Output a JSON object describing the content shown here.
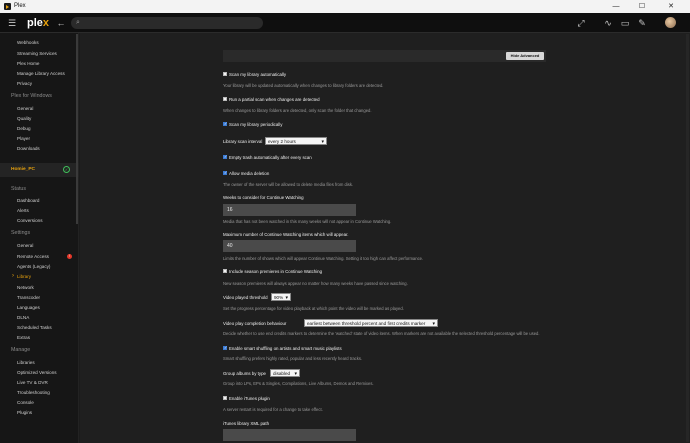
{
  "window": {
    "title": "Plex",
    "min": "—",
    "max": "☐",
    "close": "✕"
  },
  "topbar": {
    "logo_left": "ple",
    "logo_x": "x"
  },
  "sidebar": {
    "top_items": [
      "Webhooks",
      "Streaming Services",
      "Plex Home",
      "Manage Library Access",
      "Privacy"
    ],
    "windows_header": "Plex for Windows",
    "windows_items": [
      "General",
      "Quality",
      "Debug",
      "Player",
      "Downloads"
    ],
    "server_name": "Homie_PC",
    "status_header": "Status",
    "status_items": [
      "Dashboard",
      "Alerts",
      "Conversions"
    ],
    "settings_header": "Settings",
    "settings_items": [
      "General",
      "Remote Access",
      "Agents (Legacy)",
      "Library",
      "Network",
      "Transcoder",
      "Languages",
      "DLNA",
      "Scheduled Tasks",
      "Extras"
    ],
    "remote_access_badge": "!",
    "manage_header": "Manage",
    "manage_items": [
      "Libraries",
      "Optimized Versions",
      "Live TV & DVR",
      "Troubleshooting",
      "Console",
      "Plugins"
    ]
  },
  "main": {
    "hide_advanced": "Hide Advanced",
    "scan_auto": {
      "label": "Scan my library automatically",
      "desc": "Your library will be updated automatically when changes to library folders are detected.",
      "checked": false
    },
    "partial_scan": {
      "label": "Run a partial scan when changes are detected",
      "desc": "When changes to library folders are detected, only scan the folder that changed.",
      "checked": false
    },
    "scan_periodic": {
      "label": "Scan my library periodically",
      "checked": true
    },
    "scan_interval": {
      "label": "Library scan interval",
      "value": "every 2 hours"
    },
    "empty_trash": {
      "label": "Empty trash automatically after every scan",
      "checked": true
    },
    "allow_deletion": {
      "label": "Allow media deletion",
      "desc": "The owner of the server will be allowed to delete media files from disk.",
      "checked": true
    },
    "weeks_continue": {
      "label": "Weeks to consider for Continue Watching",
      "value": "16",
      "desc": "Media that has not been watched in this many weeks will not appear in Continue Watching."
    },
    "max_continue": {
      "label": "Maximum number of Continue Watching items which will appear.",
      "value": "40",
      "desc": "Limits the number of shows which will appear Continue Watching. Setting it too high can affect performance."
    },
    "season_premieres": {
      "label": "Include season premieres in Continue Watching",
      "desc": "New season premieres will always appear no matter how many weeks have passed since watching.",
      "checked": false
    },
    "played_threshold": {
      "label": "Video played threshold",
      "value": "90%",
      "desc": "Set the progress percentage for video playback at which point the video will be marked as played."
    },
    "completion_behaviour": {
      "label": "Video play completion behaviour",
      "value": "earliest between threshold percent and first credits marker",
      "desc": "Decide whether to use end credits markers to determine the 'watched' state of video items. When markers are not available the selected threshold percentage will be used."
    },
    "smart_shuffle": {
      "label": "Enable smart shuffling on artists and smart music playlists",
      "desc": "Smart shuffling prefers highly rated, popular and less recently heard tracks.",
      "checked": true
    },
    "group_albums": {
      "label": "Group albums by type",
      "value": "disabled",
      "desc": "Group into LPs, EPs & Singles, Compilations, Live Albums, Demos and Remixes."
    },
    "itunes_plugin": {
      "label": "Enable iTunes plugin",
      "desc": "A server restart is required for a change to take effect.",
      "checked": false
    },
    "itunes_path": {
      "label": "iTunes library XML path",
      "value": ""
    }
  },
  "colors": {
    "accent": "#e5a00d",
    "background": "#1f1f1f",
    "sidebar": "#161616",
    "checkbox_on": "#3a7bd5",
    "badge": "#e5382a"
  }
}
